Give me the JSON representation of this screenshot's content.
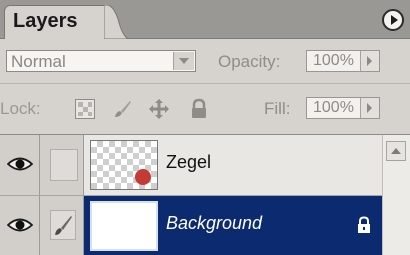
{
  "panel": {
    "tab_title": "Layers",
    "menu_icon": "flyout-menu-icon"
  },
  "blend": {
    "mode": "Normal",
    "opacity_label": "Opacity:",
    "opacity_value": "100%"
  },
  "lock": {
    "label": "Lock:",
    "icons": [
      "lock-transparent-icon",
      "lock-image-brush-icon",
      "lock-position-move-icon",
      "lock-all-padlock-icon"
    ],
    "fill_label": "Fill:",
    "fill_value": "100%"
  },
  "layers": [
    {
      "name": "Zegel",
      "visible": true,
      "selected": false,
      "thumbnail": "transparent-with-red-dot"
    },
    {
      "name": "Background",
      "visible": true,
      "selected": true,
      "locked": true,
      "thumbnail": "white"
    }
  ],
  "colors": {
    "selection": "#0b2a6f",
    "panel_bg": "#d6d3ce",
    "seal_red": "#c43a34"
  }
}
